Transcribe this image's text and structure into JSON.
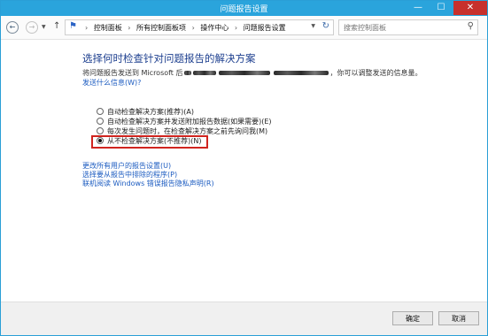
{
  "window": {
    "title": "问题报告设置",
    "min_glyph": "—",
    "max_glyph": "☐",
    "close_glyph": "✕"
  },
  "nav": {
    "back_glyph": "←",
    "forward_glyph": "→",
    "up_glyph": "↑",
    "breadcrumb": [
      "控制面板",
      "所有控制面板项",
      "操作中心",
      "问题报告设置"
    ],
    "crumb_separator": "›",
    "search_placeholder": "搜索控制面板"
  },
  "main": {
    "heading": "选择何时检查针对问题报告的解决方案",
    "desc_part1": "将问题报告发送到 Microsoft 后",
    "desc_part2": "，你可以调整发送的信息量。",
    "about_link": "发送什么信息(W)?",
    "options": [
      {
        "label": "自动检查解决方案(推荐)(A)",
        "selected": false
      },
      {
        "label": "自动检查解决方案并发送附加报告数据(如果需要)(E)",
        "selected": false
      },
      {
        "label": "每次发生问题时，在检查解决方案之前先询问我(M)",
        "selected": false
      },
      {
        "label": "从不检查解决方案(不推荐)(N)",
        "selected": true
      }
    ],
    "links": [
      "更改所有用户的报告设置(U)",
      "选择要从报告中排除的程序(P)",
      "联机阅读 Windows 错误报告隐私声明(R)"
    ]
  },
  "footer": {
    "ok": "确定",
    "cancel": "取消"
  },
  "colors": {
    "titlebar": "#2aa4dc",
    "link": "#1b5bc0",
    "heading": "#1d3f8f",
    "highlight": "#d0241f"
  }
}
